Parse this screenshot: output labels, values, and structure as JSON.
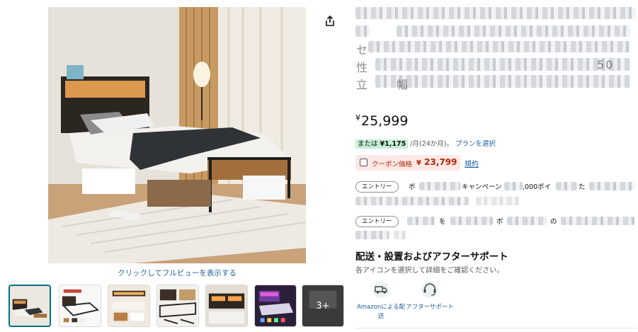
{
  "gallery": {
    "fullview_label": "クリックしてフルビューを表示する",
    "more_label": "3+",
    "thumbnails": [
      "bed-front",
      "bed-frame",
      "bed-storage",
      "bed-detail",
      "bed-headboard",
      "bed-night"
    ]
  },
  "product": {
    "title_fragments": [
      "セ",
      "性",
      "立",
      "幅",
      "50"
    ],
    "price_symbol": "¥",
    "price": "25,999",
    "monthly": {
      "prefix": "または",
      "amount": "¥1,175",
      "suffix": "/月(24か月)。",
      "plan_link": "プランを選択"
    },
    "coupon": {
      "label": "クーポン価格",
      "price_symbol": "¥",
      "price": "23,799",
      "terms_link": "規約"
    }
  },
  "promotions": [
    {
      "pill": "エントリー",
      "text": "ポ",
      "text_2": "キャンペーン",
      "text_3": ",000ポイ",
      "text_4": "た"
    },
    {
      "pill": "エントリー",
      "text": "を",
      "text_2": "ポ",
      "text_3": "の"
    }
  ],
  "support": {
    "title": "配送・設置およびアフターサポート",
    "subtitle": "各アイコンを選択して詳細をご確認ください。",
    "items": [
      {
        "icon": "truck-icon",
        "label": "Amazonによる配送"
      },
      {
        "icon": "headset-icon",
        "label": "アフターサポート"
      }
    ]
  }
}
